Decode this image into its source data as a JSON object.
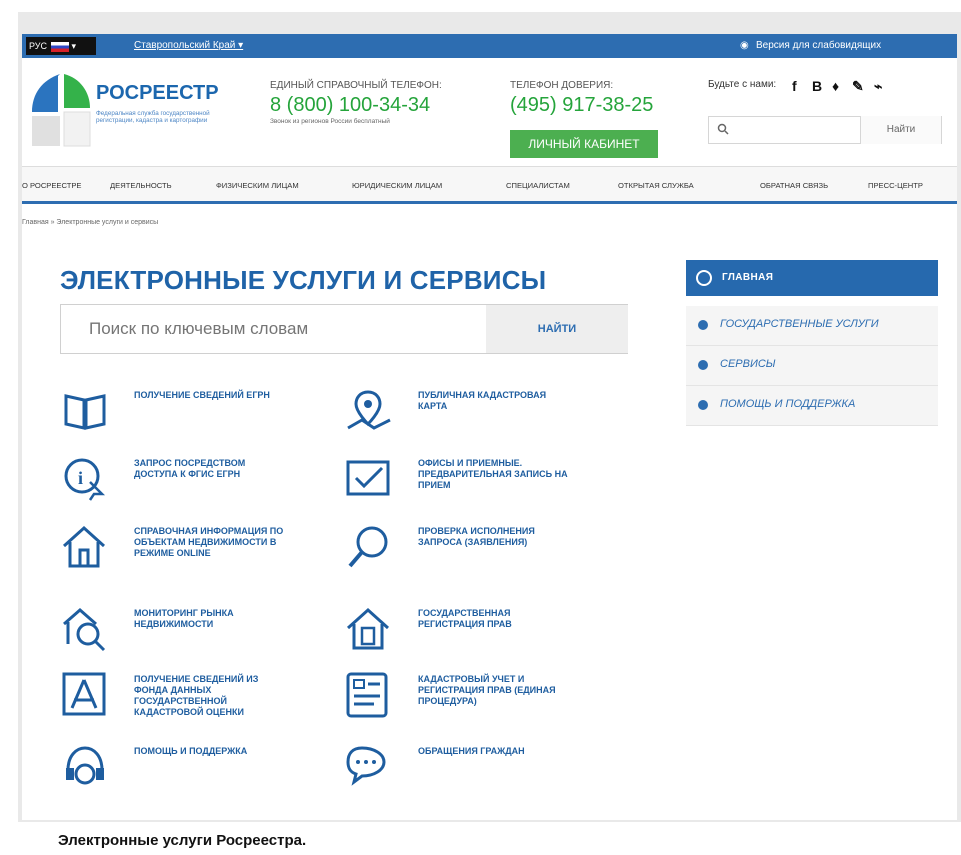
{
  "topbar": {
    "language": "РУС",
    "region": "Ставропольский Край ▾",
    "low_vision": "Версия для слабовидящих"
  },
  "header": {
    "brand": "РОСРЕЕСТР",
    "brand_sub": "Федеральная служба государственной регистрации, кадастра и картографии",
    "helpline_label": "ЕДИНЫЙ СПРАВОЧНЫЙ ТЕЛЕФОН:",
    "helpline_number": "8 (800) 100-34-34",
    "helpline_note": "Звонок из регионов России бесплатный",
    "trust_label": "ТЕЛЕФОН ДОВЕРИЯ:",
    "trust_number": "(495) 917-38-25",
    "cabinet": "ЛИЧНЫЙ КАБИНЕТ",
    "follow": "Будьте с нами:",
    "search_button": "Найти"
  },
  "nav": [
    "О РОСРЕЕСТРЕ",
    "ДЕЯТЕЛЬНОСТЬ",
    "ФИЗИЧЕСКИМ ЛИЦАМ",
    "ЮРИДИЧЕСКИМ ЛИЦАМ",
    "СПЕЦИАЛИСТАМ",
    "ОТКРЫТАЯ СЛУЖБА",
    "ОБРАТНАЯ СВЯЗЬ",
    "ПРЕСС-ЦЕНТР"
  ],
  "breadcrumb": "Главная » Электронные услуги и сервисы",
  "page": {
    "title": "ЭЛЕКТРОННЫЕ УСЛУГИ И СЕРВИСЫ",
    "search_placeholder": "Поиск по ключевым словам",
    "search_button": "НАЙТИ"
  },
  "services": [
    "ПОЛУЧЕНИЕ СВЕДЕНИЙ ЕГРН",
    "ПУБЛИЧНАЯ КАДАСТРОВАЯ КАРТА",
    "ЗАПРОС ПОСРЕДСТВОМ ДОСТУПА К ФГИС ЕГРН",
    "ОФИСЫ И ПРИЕМНЫЕ. ПРЕДВАРИТЕЛЬНАЯ ЗАПИСЬ НА ПРИЕМ",
    "СПРАВОЧНАЯ ИНФОРМАЦИЯ ПО ОБЪЕКТАМ НЕДВИЖИМОСТИ В РЕЖИМЕ ONLINE",
    "ПРОВЕРКА ИСПОЛНЕНИЯ ЗАПРОСА (ЗАЯВЛЕНИЯ)",
    "МОНИТОРИНГ РЫНКА НЕДВИЖИМОСТИ",
    "ГОСУДАРСТВЕННАЯ РЕГИСТРАЦИЯ ПРАВ",
    "ПОЛУЧЕНИЕ СВЕДЕНИЙ ИЗ ФОНДА ДАННЫХ ГОСУДАРСТВЕННОЙ КАДАСТРОВОЙ ОЦЕНКИ",
    "КАДАСТРОВЫЙ УЧЕТ И РЕГИСТРАЦИЯ ПРАВ (ЕДИНАЯ ПРОЦЕДУРА)",
    "ПОМОЩЬ И ПОДДЕРЖКА",
    "ОБРАЩЕНИЯ ГРАЖДАН"
  ],
  "sidebar": {
    "home": "ГЛАВНАЯ",
    "items": [
      "ГОСУДАРСТВЕННЫЕ УСЛУГИ",
      "СЕРВИСЫ",
      "ПОМОЩЬ И ПОДДЕРЖКА"
    ]
  },
  "caption": "Электронные услуги Росреестра."
}
